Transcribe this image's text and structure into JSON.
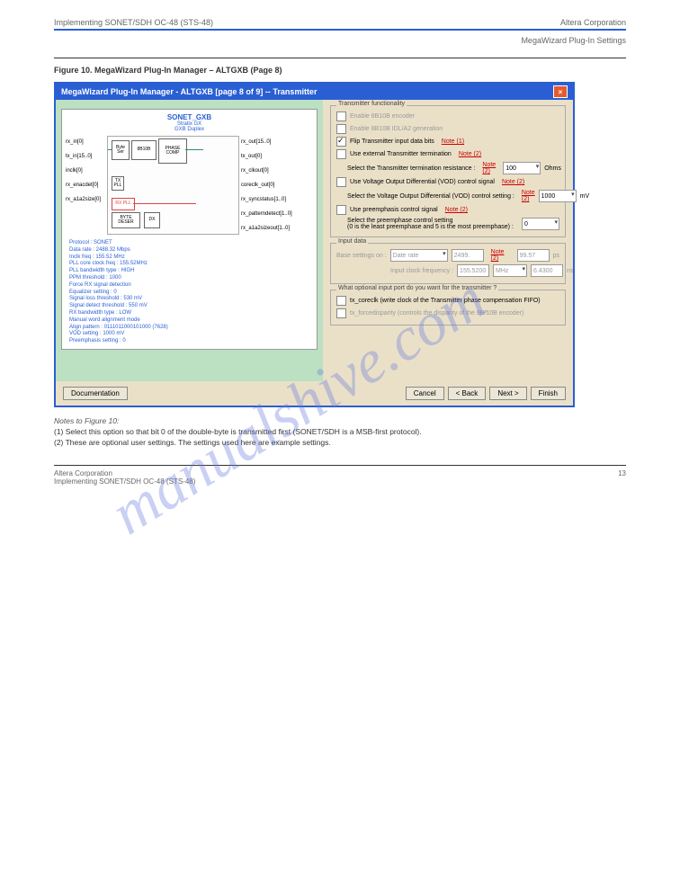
{
  "page": {
    "header_left": "Implementing SONET/SDH OC-48 (STS-48)",
    "header_right": "Altera Corporation",
    "header_right2": "MegaWizard Plug-In Settings",
    "figure_caption": "Figure 10. MegaWizard Plug-In Manager – ALTGXB (Page 8)",
    "footer_left": "Implementing SONET/SDH OC-48 (STS-48)",
    "footer_right": "Altera Corporation",
    "page_number": "13"
  },
  "dialog": {
    "title": "MegaWizard Plug-In Manager - ALTGXB [page 8 of 9] -- Transmitter",
    "preview": {
      "title": "SONET_GXB",
      "sub1": "Stratix GX",
      "sub2": "GXB Duplex",
      "ports_left": [
        "rx_in[0]",
        "tx_in[15..0]",
        "inclk[0]",
        "rx_enacdet[0]",
        "rx_a1a2size[0]"
      ],
      "ports_right": [
        "rx_out[15..0]",
        "tx_out[0]",
        "rx_clkout[0]",
        "coreclk_out[0]",
        "rx_syncstatus[1..0]",
        "rx_patterndetect[1..0]",
        "rx_a1a2sizeout[1..0]"
      ],
      "params": [
        "Protocol : SONET",
        "Data rate : 2488.32 Mbps",
        "Inclk freq : 155.52 MHz",
        "PLL core clock freq : 155.52MHz",
        "PLL bandwidth type : HIGH",
        "PPM threshold : 1000",
        "Force RX signal detection",
        "Equalizer setting : 0",
        "Signal loss threshold : 530 mV",
        "Signal detect threshold : 550 mV",
        "RX bandwidth type : LOW",
        "Manual word alignment mode",
        "Align pattern : 0111011000101000 (7628)",
        "VOD setting : 1000 mV",
        "Preemphasis setting : 0"
      ]
    },
    "functionality": {
      "group_label": "Transmitter functionality",
      "enable_8b10b": "Enable 8B10B encoder",
      "enable_idle_az": "Enable 8B10B IDL/A2 generation",
      "flip_bits": "Flip Transmitter input data bits",
      "note1": "Note (1)",
      "ext_term": "Use external Transmitter termination",
      "note2a": "Note (2)",
      "term_resistance_lbl": "Select the Transmitter termination resistance :",
      "term_resistance_val": "100",
      "term_resistance_unit": "Ohms",
      "vod_signal": "Use Voltage Output Differential (VOD) control signal",
      "note2b": "Note (2)",
      "vod_setting_lbl": "Select the Voltage Output Differential (VOD) control setting :",
      "vod_setting_val": "1000",
      "vod_setting_unit": "mV",
      "note2c": "Note (2)",
      "preemph_signal": "Use preemphasis control signal",
      "note2d": "Note (2)",
      "preemph_setting_lbl": "Select the preemphase control setting\n(0 is the least preemphase and 5 is the most preemphase) :",
      "preemph_setting_val": "0"
    },
    "input_data": {
      "group_label": "Input data",
      "base_lbl": "Base settings on :",
      "base_val": "Date rate",
      "rate_val": "2499.",
      "note2e": "Note (2)",
      "mbps_val": "99.57",
      "mbps_unit": "ps",
      "clock_lbl": "Input clock frequency :",
      "clock_val": "155.5200",
      "clock_unit": "MHz",
      "clock_period": "6.4300",
      "clock_period_unit": "ns"
    },
    "optional": {
      "group_label": "What optional input port do you want for the transmitter ?",
      "txcoreclk": "tx_coreclk  (write clock of the Transmitter phase compensation FIFO)",
      "txforcedisp": "tx_forcedisparity (controls the disparity of the 8B/10B encoder)"
    },
    "buttons": {
      "doc": "Documentation",
      "cancel": "Cancel",
      "back": "< Back",
      "next": "Next >",
      "finish": "Finish"
    }
  },
  "notes": {
    "heading": "Notes to Figure 10:",
    "n1": "(1)  Select this option so that bit 0 of the double-byte is transmitted first (SONET/SDH is a MSB-first protocol).",
    "n2": "(2)  These are optional user settings. The settings used here are example settings."
  },
  "watermark": "manualshive.com"
}
